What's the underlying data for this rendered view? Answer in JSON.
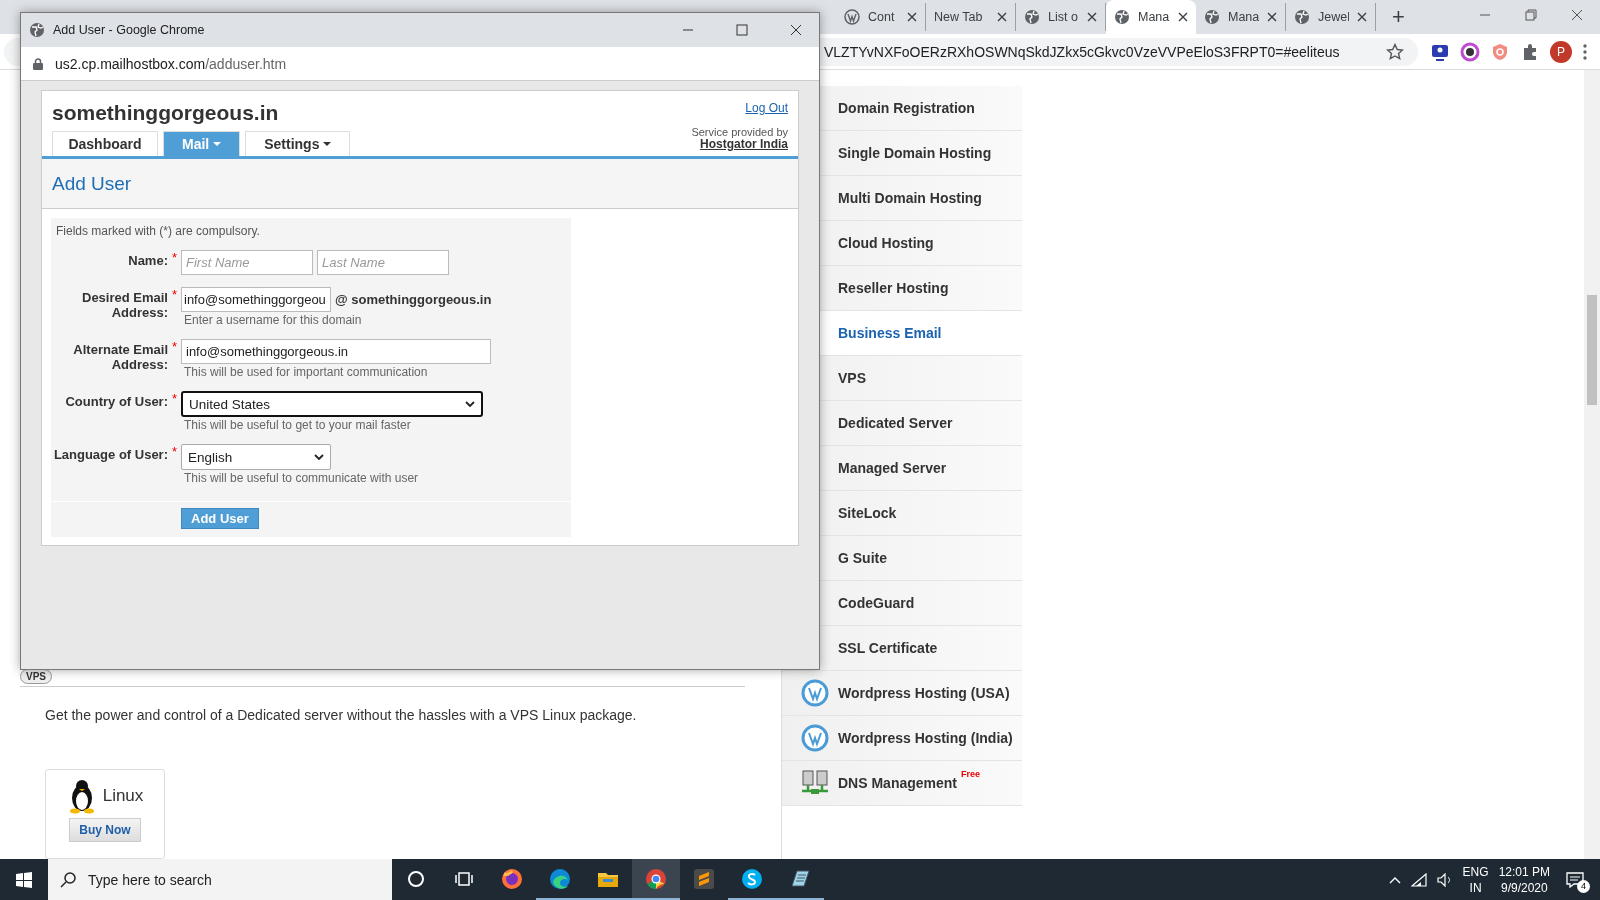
{
  "browser": {
    "tabs": [
      {
        "label": "Cont",
        "selected": false
      },
      {
        "label": "New Tab",
        "selected": false
      },
      {
        "label": "List o",
        "selected": false
      },
      {
        "label": "Mana",
        "selected": true
      },
      {
        "label": "Mana",
        "selected": false
      },
      {
        "label": "Jewel",
        "selected": false
      }
    ],
    "new_tab": "+",
    "address": "VLZTYvNXFoOERzRXhOSWNqSkdJZkx5cGkvc0VzeVVPeEloS3FRPT0=#eeliteus",
    "profile_initial": "P"
  },
  "page": {
    "section_badge": "VPS",
    "description": "Get the power and control of a Dedicated server without the hassles with a VPS Linux package.",
    "products": [
      {
        "name": "Linux",
        "button": "Buy Now"
      }
    ]
  },
  "sidebar": {
    "items": [
      {
        "label": "Domain Registration",
        "selected": false
      },
      {
        "label": "Single Domain Hosting",
        "selected": false
      },
      {
        "label": "Multi Domain Hosting",
        "selected": false
      },
      {
        "label": "Cloud Hosting",
        "selected": false
      },
      {
        "label": "Reseller Hosting",
        "selected": false
      },
      {
        "label": "Business Email",
        "selected": true
      },
      {
        "label": "VPS",
        "selected": false
      },
      {
        "label": "Dedicated Server",
        "selected": false
      },
      {
        "label": "Managed Server",
        "selected": false
      },
      {
        "label": "SiteLock",
        "selected": false
      },
      {
        "label": "G Suite",
        "selected": false
      },
      {
        "label": "CodeGuard",
        "selected": false
      },
      {
        "label": "SSL Certificate",
        "selected": false
      },
      {
        "label": "Wordpress Hosting (USA)",
        "selected": false
      },
      {
        "label": "Wordpress Hosting (India)",
        "selected": false
      },
      {
        "label": "DNS Management",
        "badge": "Free",
        "selected": false
      }
    ]
  },
  "popup": {
    "title": "Add User - Google Chrome",
    "url_host": "us2.cp.mailhostbox.com",
    "url_path": "/adduser.htm",
    "site": "somethinggorgeous.in",
    "nav": [
      {
        "label": "Dashboard",
        "dropdown": false,
        "selected": false
      },
      {
        "label": "Mail",
        "dropdown": true,
        "selected": true
      },
      {
        "label": "Settings",
        "dropdown": true,
        "selected": false
      }
    ],
    "logout": "Log Out",
    "service_label": "Service provided by",
    "provider": "Hostgator India",
    "heading": "Add User",
    "form": {
      "note": "Fields marked with (*) are compulsory.",
      "required_mark": "*",
      "fields": [
        {
          "kind": "name",
          "label": "Name:",
          "required": true,
          "inputs": [
            {
              "placeholder": "First Name"
            },
            {
              "placeholder": "Last Name"
            }
          ]
        },
        {
          "kind": "email",
          "label": "Desired Email Address:",
          "required": true,
          "value": "info@somethinggorgeou",
          "suffix": "@ somethinggorgeous.in",
          "hint": "Enter a username for this domain"
        },
        {
          "kind": "text",
          "label": "Alternate Email Address:",
          "required": true,
          "value": "info@somethinggorgeous.in",
          "hint": "This will be used for important communication"
        },
        {
          "kind": "select",
          "label": "Country of User:",
          "required": true,
          "value": "United States",
          "focused": true,
          "hint": "This will be useful to get to your mail faster"
        },
        {
          "kind": "select",
          "label": "Language of User:",
          "required": true,
          "value": "English",
          "focused": false,
          "hint": "This will be useful to communicate with user"
        }
      ],
      "submit": "Add User"
    }
  },
  "taskbar": {
    "search_placeholder": "Type here to search",
    "language": "ENG",
    "region": "IN",
    "time": "12:01 PM",
    "date": "9/9/2020",
    "notifications": "4"
  }
}
